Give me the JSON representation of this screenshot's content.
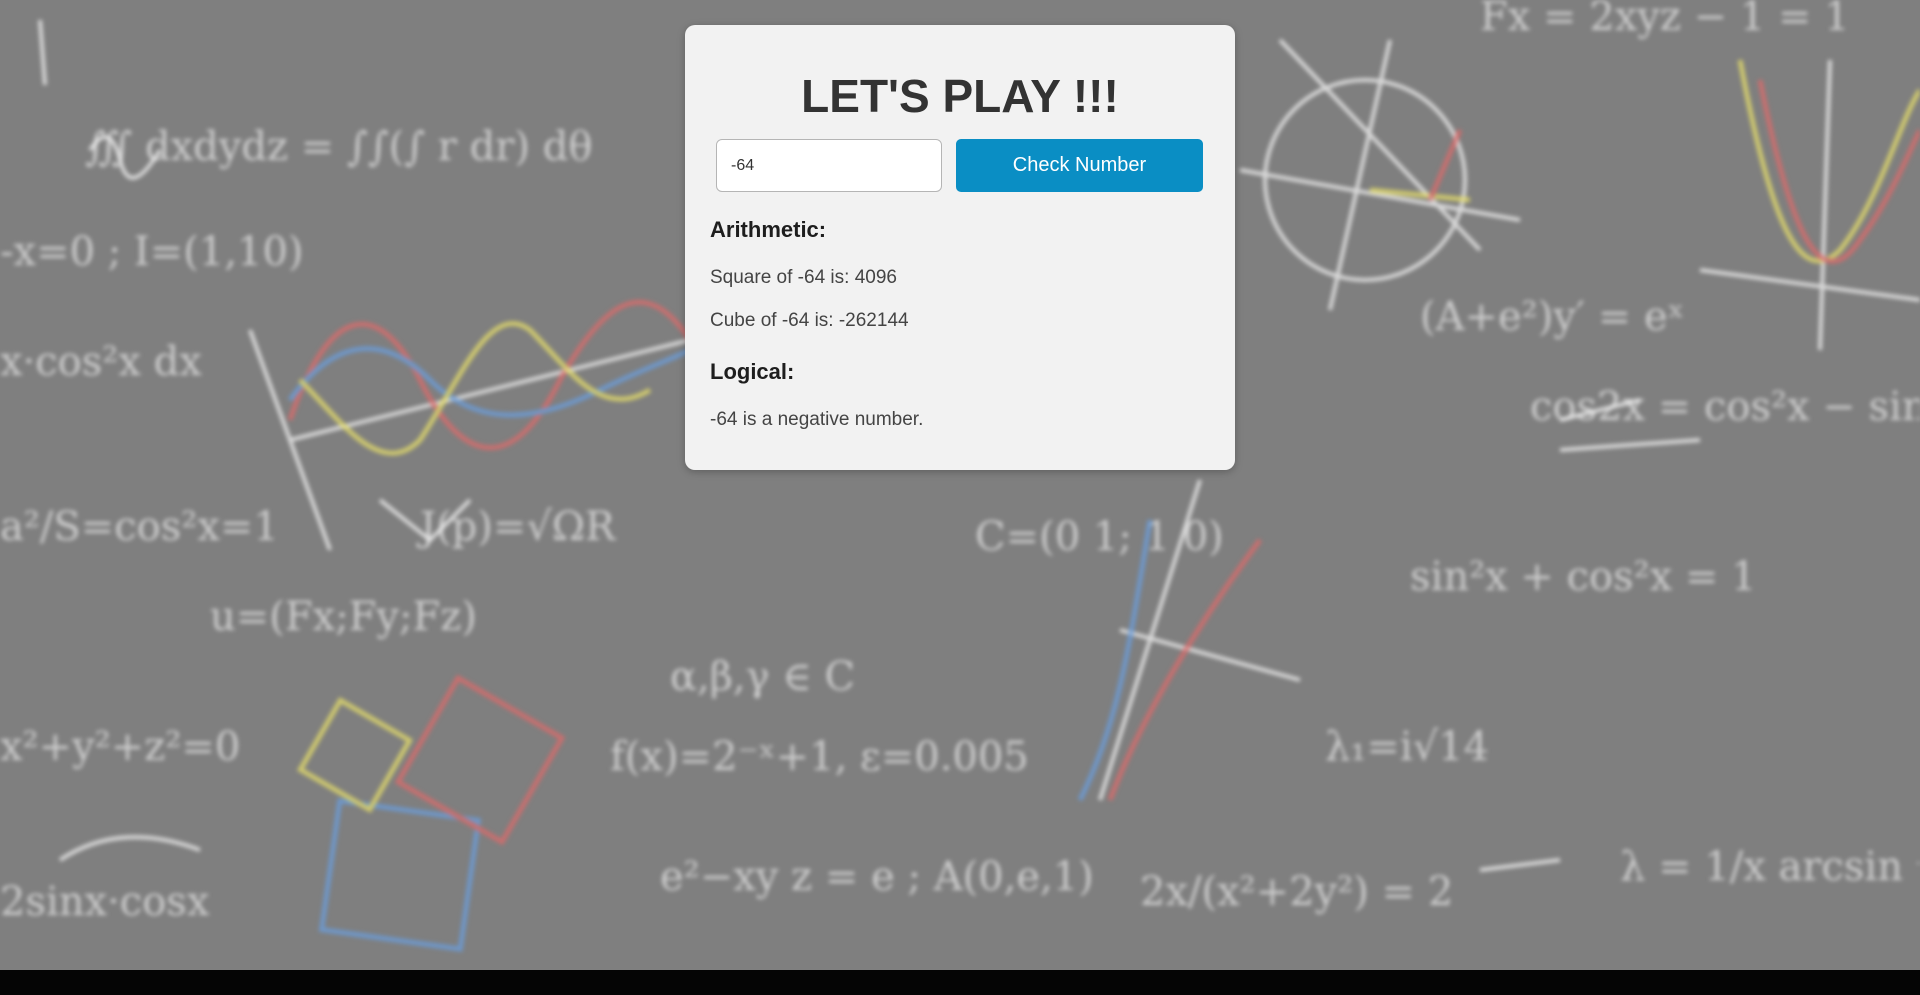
{
  "card": {
    "title": "LET'S PLAY !!!",
    "input": {
      "value": "-64",
      "placeholder": ""
    },
    "check_button_label": "Check Number",
    "arithmetic": {
      "heading": "Arithmetic:",
      "square_text": "Square of -64 is: 4096",
      "cube_text": "Cube of -64 is: -262144"
    },
    "logical": {
      "heading": "Logical:",
      "sign_text": "-64 is a negative number."
    }
  },
  "colors": {
    "background": "#7f7f7f",
    "card": "#f2f2f2",
    "button": "#0a8ec4",
    "title": "#333333"
  }
}
